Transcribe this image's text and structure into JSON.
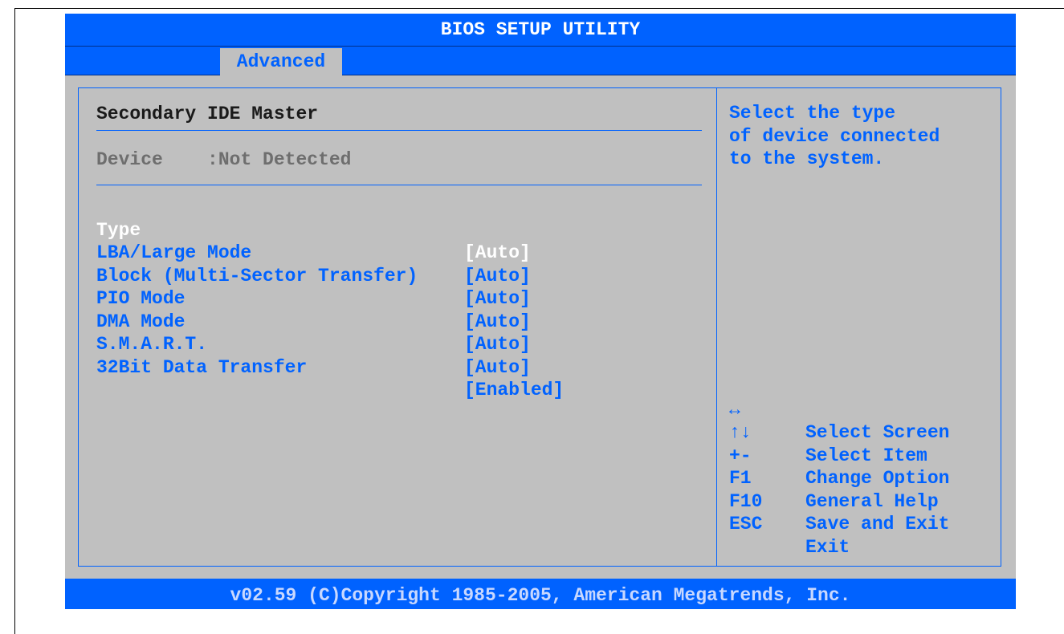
{
  "title": "BIOS SETUP UTILITY",
  "tabs": [
    {
      "label": "Advanced",
      "active": true
    }
  ],
  "section_title": "Secondary IDE Master",
  "device": {
    "label": "Device",
    "value": ":Not Detected"
  },
  "settings": [
    {
      "label": "Type",
      "value": "[Auto]",
      "selected": true
    },
    {
      "label": "LBA/Large Mode",
      "value": "[Auto]",
      "selected": false
    },
    {
      "label": "Block (Multi-Sector Transfer)",
      "value": "[Auto]",
      "selected": false
    },
    {
      "label": "PIO Mode",
      "value": "[Auto]",
      "selected": false
    },
    {
      "label": "DMA Mode",
      "value": "[Auto]",
      "selected": false
    },
    {
      "label": "S.M.A.R.T.",
      "value": "[Auto]",
      "selected": false
    },
    {
      "label": "32Bit Data Transfer",
      "value": "[Enabled]",
      "selected": false
    }
  ],
  "help": {
    "lines": [
      "Select the type",
      "of device connected",
      "to the system."
    ]
  },
  "keys": [
    {
      "key": "↔",
      "description": "Select Screen"
    },
    {
      "key": "↑↓",
      "description": "Select Item"
    },
    {
      "key": "+-",
      "description": "Change Option"
    },
    {
      "key": "F1",
      "description": "General Help"
    },
    {
      "key": "F10",
      "description": "Save and Exit"
    },
    {
      "key": "ESC",
      "description": "Exit"
    }
  ],
  "footer": "v02.59 (C)Copyright 1985-2005, American Megatrends, Inc.",
  "colors": {
    "accent": "#0062ff",
    "background": "#c0c0c0",
    "selected_text": "#ffffff"
  }
}
